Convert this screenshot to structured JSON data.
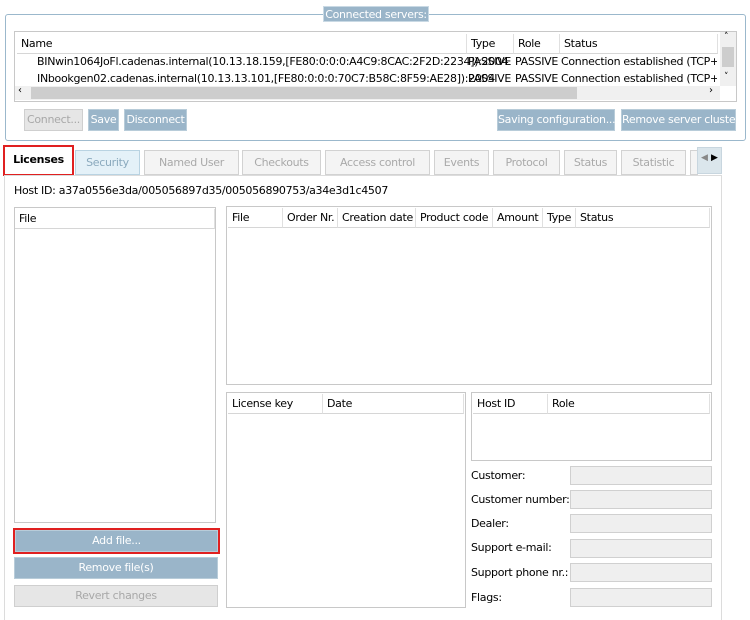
{
  "servers": {
    "legend": "Connected servers:",
    "columns": [
      "Name",
      "Type",
      "Role",
      "Status"
    ],
    "rows": [
      {
        "name": "BINwin1064JoFl.cadenas.internal(10.13.18.159,[FE80:0:0:0:A4C9:8CAC:2F2D:2234]):2004",
        "type": "PASSIVE",
        "role": "PASSIVE",
        "status": "Connection established (TCP+U"
      },
      {
        "name": "INbookgen02.cadenas.internal(10.13.13.101,[FE80:0:0:0:70C7:B58C:8F59:AE28]):2004",
        "type": "PASSIVE",
        "role": "PASSIVE",
        "status": "Connection established (TCP+U"
      }
    ],
    "buttons": {
      "connect": "Connect...",
      "save": "Save",
      "disconnect": "Disconnect",
      "saving": "Saving configuration...",
      "remove": "Remove server cluster"
    }
  },
  "tabs": [
    "Licenses",
    "Security",
    "Named User",
    "Checkouts",
    "Access control",
    "Events",
    "Protocol",
    "Status",
    "Statistic"
  ],
  "licenses": {
    "host_id_label": "Host ID:",
    "host_id": "a37a0556e3da/005056897d35/005056890753/a34e3d1c4507",
    "file_list_header": "File",
    "file_columns": [
      "File",
      "Order Nr.",
      "Creation date",
      "Product code",
      "Amount",
      "Type",
      "Status"
    ],
    "key_columns": [
      "License key",
      "Date"
    ],
    "host_columns": [
      "Host ID",
      "Role"
    ],
    "fields": [
      "Customer:",
      "Customer number:",
      "Dealer:",
      "Support e-mail:",
      "Support phone nr.:",
      "Flags:"
    ],
    "buttons": {
      "add": "Add file...",
      "remove": "Remove file(s)",
      "revert": "Revert changes"
    }
  }
}
